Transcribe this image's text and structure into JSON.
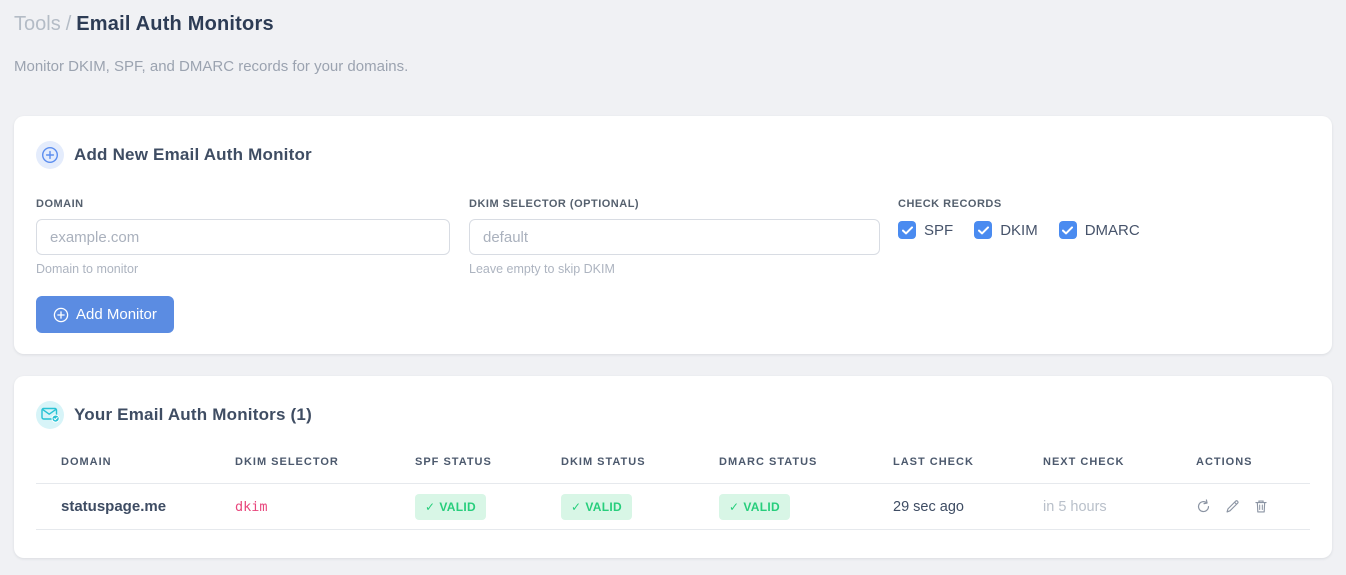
{
  "page": {
    "breadcrumb": {
      "section": "Tools",
      "separator": "/",
      "current": "Email Auth Monitors"
    },
    "subtitle": "Monitor DKIM, SPF, and DMARC records for your domains."
  },
  "add_monitor_card": {
    "title": "Add New Email Auth Monitor",
    "icon": "plus-circle-icon",
    "domain_field": {
      "label": "DOMAIN",
      "value": "",
      "placeholder": "example.com",
      "helper": "Domain to monitor"
    },
    "dkim_selector_field": {
      "label": "DKIM SELECTOR (OPTIONAL)",
      "value": "",
      "placeholder": "default",
      "helper": "Leave empty to skip DKIM"
    },
    "check_records": {
      "label": "CHECK RECORDS",
      "options": [
        {
          "label": "SPF",
          "checked": true
        },
        {
          "label": "DKIM",
          "checked": true
        },
        {
          "label": "DMARC",
          "checked": true
        }
      ]
    },
    "submit_label": "Add Monitor"
  },
  "monitors_card": {
    "title": "Your Email Auth Monitors (1)",
    "icon": "mail-check-icon",
    "table": {
      "headers": [
        "DOMAIN",
        "DKIM SELECTOR",
        "SPF STATUS",
        "DKIM STATUS",
        "DMARC STATUS",
        "LAST CHECK",
        "NEXT CHECK",
        "ACTIONS"
      ],
      "rows": [
        {
          "domain": "statuspage.me",
          "dkim_selector": "dkim",
          "spf_status": {
            "glyph": "✓",
            "label": "VALID"
          },
          "dkim_status": {
            "glyph": "✓",
            "label": "VALID"
          },
          "dmarc_status": {
            "glyph": "✓",
            "label": "VALID"
          },
          "last_check": "29 sec ago",
          "next_check": "in 5 hours",
          "actions": [
            "refresh",
            "edit",
            "delete"
          ]
        }
      ]
    }
  },
  "colors": {
    "page_background": "#f0f1f4",
    "primary_blue": "#4a8bf0",
    "button_blue": "#5b8ce2",
    "badge_green_bg": "#d8f6e6",
    "badge_green_text": "#27ce7c",
    "selector_pink": "#e8467c",
    "teal_icon": "#27c2d4",
    "heading_dark": "#2d3c55"
  }
}
